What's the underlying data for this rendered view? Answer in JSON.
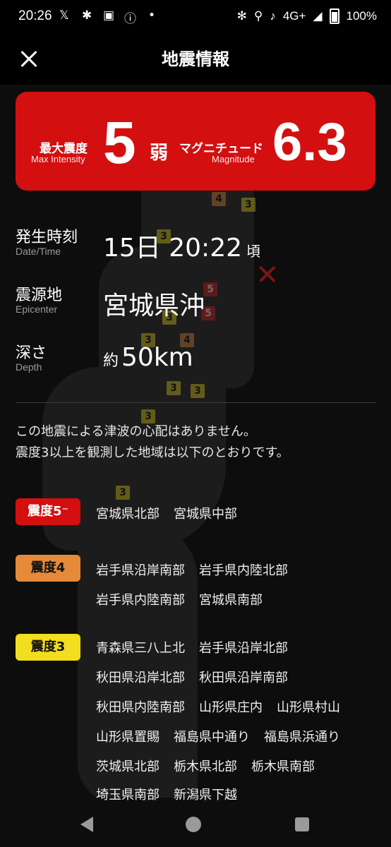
{
  "status_bar": {
    "time": "20:26",
    "left_icons": [
      "x-logo-icon",
      "notification-icon",
      "app-icon",
      "info-icon",
      "dot-icon"
    ],
    "network": "4G+",
    "battery": "100%"
  },
  "header": {
    "title": "地震情報",
    "close_icon": "close-icon"
  },
  "summary_card": {
    "color": "#d30f0f",
    "max_intensity_label": "最大震度",
    "max_intensity_sub": "Max Intensity",
    "max_intensity_value": "5",
    "max_intensity_suffix": "弱",
    "magnitude_label": "マグニチュード",
    "magnitude_sub": "Magnitude",
    "magnitude_value": "6.3"
  },
  "details": {
    "datetime_label": "発生時刻",
    "datetime_sub": "Date/Time",
    "datetime_value": "15日 20:22",
    "datetime_suffix": "頃",
    "epicenter_label": "震源地",
    "epicenter_sub": "Epicenter",
    "epicenter_value": "宮城県沖",
    "depth_label": "深さ",
    "depth_sub": "Depth",
    "depth_prefix": "約",
    "depth_value": "50km"
  },
  "notice": {
    "line1": "この地震による津波の心配はありません。",
    "line2": "震度3以上を観測した地域は以下のとおりです。"
  },
  "intensity_groups": [
    {
      "label": "震度5⁻",
      "color": "#d30f0f",
      "text_color": "#ffffff",
      "lines": [
        [
          "宮城県北部",
          "宮城県中部"
        ]
      ]
    },
    {
      "label": "震度4",
      "color": "#e48a3a",
      "text_color": "#111111",
      "lines": [
        [
          "岩手県沿岸南部",
          "岩手県内陸北部"
        ],
        [
          "岩手県内陸南部",
          "宮城県南部"
        ]
      ]
    },
    {
      "label": "震度3",
      "color": "#f2dd1e",
      "text_color": "#111111",
      "lines": [
        [
          "青森県三八上北",
          "岩手県沿岸北部"
        ],
        [
          "秋田県沿岸北部",
          "秋田県沿岸南部"
        ],
        [
          "秋田県内陸南部",
          "山形県庄内",
          "山形県村山"
        ],
        [
          "山形県置賜",
          "福島県中通り",
          "福島県浜通り"
        ],
        [
          "茨城県北部",
          "栃木県北部",
          "栃木県南部"
        ],
        [
          "埼玉県南部",
          "新潟県下越"
        ]
      ]
    }
  ],
  "map": {
    "markers": [
      {
        "v": "4"
      },
      {
        "v": "3"
      },
      {
        "v": "3"
      },
      {
        "v": "5"
      },
      {
        "v": "5"
      },
      {
        "v": "3"
      },
      {
        "v": "3"
      },
      {
        "v": "4"
      },
      {
        "v": "3"
      },
      {
        "v": "3"
      },
      {
        "v": "3"
      },
      {
        "v": "3"
      }
    ],
    "epicenter_icon": "epicenter-x-icon"
  },
  "nav_bar": {
    "back_icon": "back-icon",
    "home_icon": "home-icon",
    "recent_icon": "recent-apps-icon"
  }
}
